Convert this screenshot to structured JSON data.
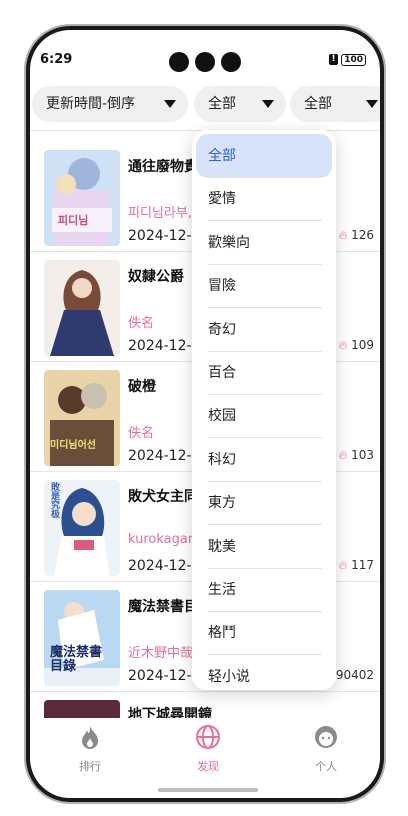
{
  "status": {
    "time": "6:29",
    "battery": "100",
    "battery_alert": "!"
  },
  "filters": [
    {
      "label": "更新時間-倒序"
    },
    {
      "label": "全部"
    },
    {
      "label": "全部"
    }
  ],
  "comics": [
    {
      "title": "通往廢物貴",
      "author": "피디님라부,",
      "date": "2024-12-",
      "count": "126",
      "cover_text": "피디님"
    },
    {
      "title": "奴隸公爵",
      "author": "佚名",
      "date": "2024-12-",
      "count": "109",
      "cover_text": ""
    },
    {
      "title": "破橙",
      "author": "佚名",
      "date": "2024-12-",
      "count": "103",
      "cover_text": "미디님어선"
    },
    {
      "title": "敗犬女主同",
      "author": "kurokagam",
      "date": "2024-12-",
      "count": "117",
      "cover_text": "敗是究极"
    },
    {
      "title": "魔法禁書目",
      "author": "近木野中哉",
      "date": "2024-12-",
      "count": "690402",
      "cover_text": "魔法禁書目錄"
    },
    {
      "title": "地下城尋開鏡",
      "author": "",
      "date": "",
      "count": "",
      "cover_text": ""
    }
  ],
  "dropdown": {
    "items": [
      "全部",
      "愛情",
      "歡樂向",
      "冒險",
      "奇幻",
      "百合",
      "校园",
      "科幻",
      "東方",
      "耽美",
      "生活",
      "格鬥",
      "轻小说"
    ],
    "selected": "全部"
  },
  "nav": {
    "items": [
      {
        "label": "排行",
        "icon": "flame-icon",
        "active": false
      },
      {
        "label": "发现",
        "icon": "globe-icon",
        "active": true
      },
      {
        "label": "个人",
        "icon": "face-icon",
        "active": false
      }
    ],
    "active_color": "#e8709a",
    "inactive_color": "#8a8a8a"
  },
  "colors": {
    "accent": "#e8709a",
    "selected_bg": "#d6e3fb",
    "selected_text": "#2d5fd0"
  }
}
